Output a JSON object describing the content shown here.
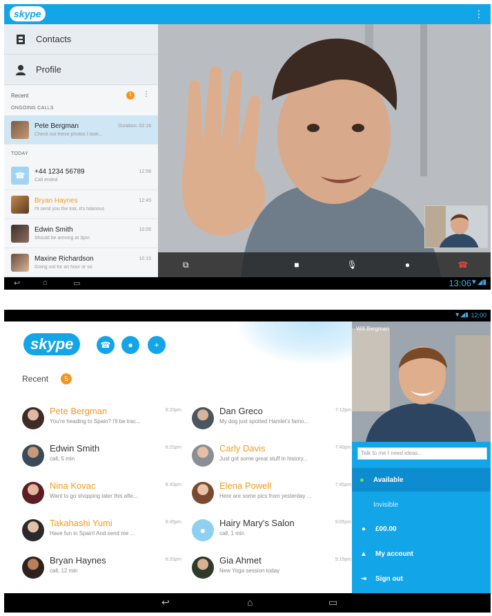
{
  "shot1": {
    "logo": "skype",
    "menu_icon": "overflow-icon",
    "nav": [
      {
        "label": "Contacts",
        "icon": "contacts-icon"
      },
      {
        "label": "Profile",
        "icon": "profile-icon"
      }
    ],
    "recent_label": "Recent",
    "recent_count": "1",
    "ongoing_label": "ONGOING CALLS",
    "today_label": "TODAY",
    "ongoing": {
      "name": "Pete Bergman",
      "message": "Check out these photos I took...",
      "time": "Duration: 02:16"
    },
    "calls": [
      {
        "name": "+44 1234 56789",
        "message": "Call ended",
        "time": "12:58",
        "highlight": false
      },
      {
        "name": "Bryan Haynes",
        "message": "I'll send you the link, it's hilarious",
        "time": "12:45",
        "highlight": true
      },
      {
        "name": "Edwin Smith",
        "message": "Should be arriving at 3pm",
        "time": "10:05",
        "highlight": false
      },
      {
        "name": "Maxine Richardson",
        "message": "Going out for an hour or so",
        "time": "10:15",
        "highlight": false
      }
    ],
    "clock": "13:06"
  },
  "shot2": {
    "clock": "12:00",
    "logo": "skype",
    "recent_label": "Recent",
    "recent_count": "5",
    "left_column": [
      {
        "name": "Pete Bergman",
        "message": "You're heading to Spain? I'll be trac...",
        "time": "8:20pm",
        "highlight": true
      },
      {
        "name": "Edwin Smith",
        "message": "call, 5 min",
        "time": "8:25pm",
        "highlight": false
      },
      {
        "name": "Nina Kovac",
        "message": "Want to go shopping later this afte...",
        "time": "8:40pm",
        "highlight": true
      },
      {
        "name": "Takahashi Yumi",
        "message": "Have fun in Spain! And send me ...",
        "time": "8:45pm",
        "highlight": true
      },
      {
        "name": "Bryan Haynes",
        "message": "call, 12 min",
        "time": "8:20pm",
        "highlight": false
      }
    ],
    "right_column": [
      {
        "name": "Dan Greco",
        "message": "My dog just spotted Hamlet's famo...",
        "time": "7:12pm",
        "highlight": false
      },
      {
        "name": "Carly Davis",
        "message": "Just got some great stuff in history...",
        "time": "7:40pm",
        "highlight": true
      },
      {
        "name": "Elena Powell",
        "message": "Here are some pics from yesterday ...",
        "time": "7:45pm",
        "highlight": true
      },
      {
        "name": "Hairy Mary's Salon",
        "message": "call, 1 min",
        "time": "9:05pm",
        "highlight": false
      },
      {
        "name": "Gia Ahmet",
        "message": "New Yoga session today",
        "time": "9:15pm",
        "highlight": false
      }
    ],
    "profile": {
      "name": "Will Bergman",
      "mood_placeholder": "Talk to me I need ideas...",
      "items": [
        {
          "label": "Available",
          "selected": true,
          "icon": "status-dot-icon"
        },
        {
          "label": "Invisible",
          "selected": false,
          "icon": ""
        },
        {
          "label": "£00.00",
          "selected": false,
          "icon": "credit-icon"
        },
        {
          "label": "My account",
          "selected": false,
          "icon": "account-icon"
        },
        {
          "label": "Sign out",
          "selected": false,
          "icon": "sign-out-icon"
        }
      ]
    }
  }
}
